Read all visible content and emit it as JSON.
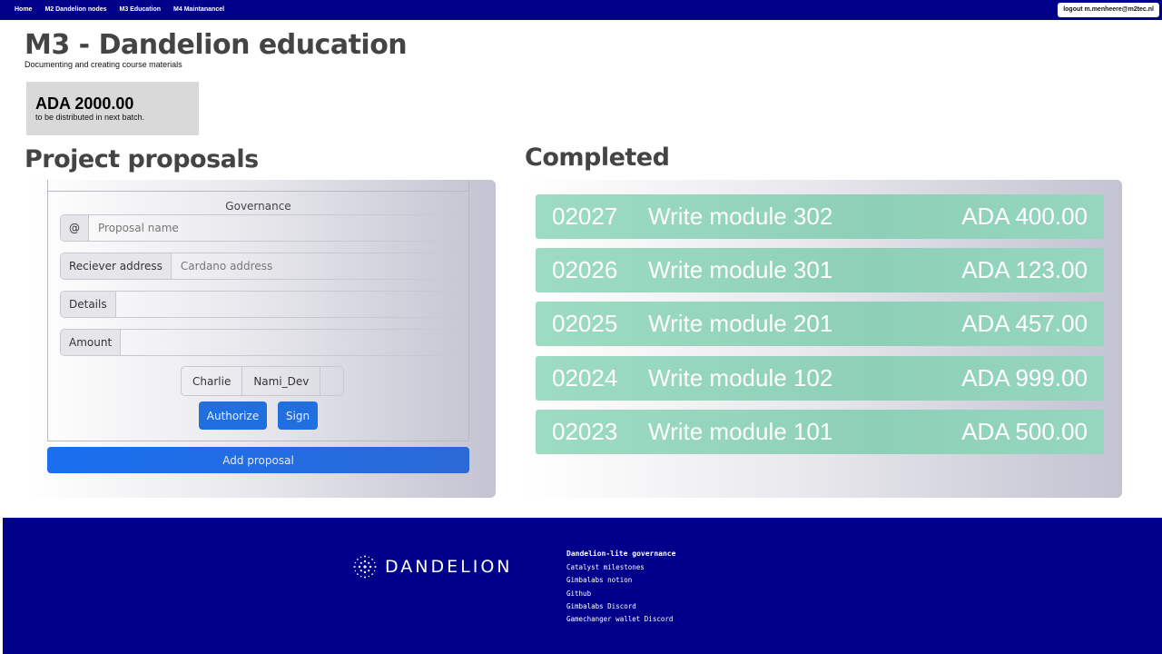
{
  "nav": {
    "links": [
      "Home",
      "M2 Dandelion nodes",
      "M3 Education",
      "M4 Maintanancel"
    ],
    "logout_label": "logout m.menheere@m2tec.nl"
  },
  "header": {
    "title": "M3 - Dandelion education",
    "subtitle": "Documenting and creating course materials"
  },
  "balance": {
    "amount": "ADA 2000.00",
    "note": "to be distributed in next batch."
  },
  "proposals": {
    "section_title": "Project proposals",
    "legend": "Governance",
    "name_prefix": "@",
    "name_placeholder": "Proposal name",
    "receiver_label": "Reciever address",
    "receiver_placeholder": "Cardano address",
    "details_label": "Details",
    "amount_label": "Amount",
    "wallets": [
      "Charlie",
      "Nami_Dev"
    ],
    "authorize_label": "Authorize",
    "sign_label": "Sign",
    "add_label": "Add proposal"
  },
  "completed": {
    "section_title": "Completed",
    "items": [
      {
        "id": "02027",
        "title": "Write module 302",
        "amount": "ADA 400.00"
      },
      {
        "id": "02026",
        "title": "Write module 301",
        "amount": "ADA 123.00"
      },
      {
        "id": "02025",
        "title": "Write module 201",
        "amount": "ADA 457.00"
      },
      {
        "id": "02024",
        "title": "Write module 102",
        "amount": "ADA 999.00"
      },
      {
        "id": "02023",
        "title": "Write module 101",
        "amount": "ADA 500.00"
      }
    ]
  },
  "footer": {
    "logo_text": "DANDELION",
    "links_title": "Dandelion-lite governance",
    "links": [
      "Catalyst milestones",
      "Gimbalabs notion",
      "Github",
      "Gimbalabs Discord",
      "Gamechanger wallet Discord"
    ]
  },
  "colors": {
    "nav_bg": "#00008b",
    "primary_button": "#1f6fe0",
    "completed_row": "#8ed0b7"
  }
}
